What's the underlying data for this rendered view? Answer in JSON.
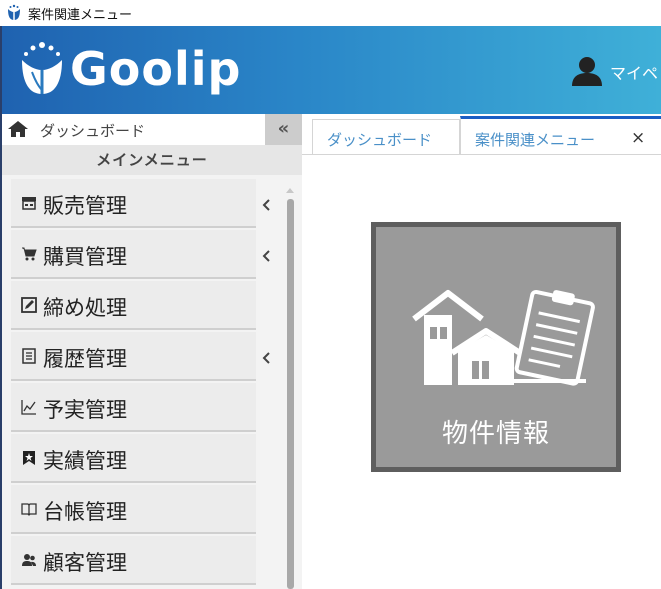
{
  "window": {
    "title": "案件関連メニュー",
    "app_icon": "goolip-tulip-icon"
  },
  "header": {
    "logo_text": "Goolip",
    "logo_icon": "tulip-logo-icon",
    "user_label": "マイペ",
    "user_icon": "user-icon",
    "gradient": [
      "#1f62b0",
      "#3fb0d8"
    ]
  },
  "sidebar": {
    "dashboard_label": "ダッシュボード",
    "collapse_label": "«",
    "menu_header": "メインメニュー",
    "items": [
      {
        "label": "販売管理",
        "icon": "store-icon",
        "has_submenu": true
      },
      {
        "label": "購買管理",
        "icon": "cart-icon",
        "has_submenu": true
      },
      {
        "label": "締め処理",
        "icon": "edit-box-icon",
        "has_submenu": false
      },
      {
        "label": "履歴管理",
        "icon": "list-icon",
        "has_submenu": true
      },
      {
        "label": "予実管理",
        "icon": "chart-line-icon",
        "has_submenu": false
      },
      {
        "label": "実績管理",
        "icon": "star-bookmark-icon",
        "has_submenu": false
      },
      {
        "label": "台帳管理",
        "icon": "book-icon",
        "has_submenu": false
      },
      {
        "label": "顧客管理",
        "icon": "users-icon",
        "has_submenu": false
      }
    ]
  },
  "tabs": [
    {
      "label": "ダッシュボード",
      "active": false
    },
    {
      "label": "案件関連メニュー",
      "active": true,
      "close_label": "×"
    }
  ],
  "content": {
    "tiles": [
      {
        "label": "物件情報",
        "icon": "house-clipboard-icon"
      }
    ]
  },
  "colors": {
    "accent": "#1a5ec4",
    "tab_text": "#4a90c8",
    "tile_bg": "#9a9a9a",
    "tile_border": "#5e5e5e"
  }
}
